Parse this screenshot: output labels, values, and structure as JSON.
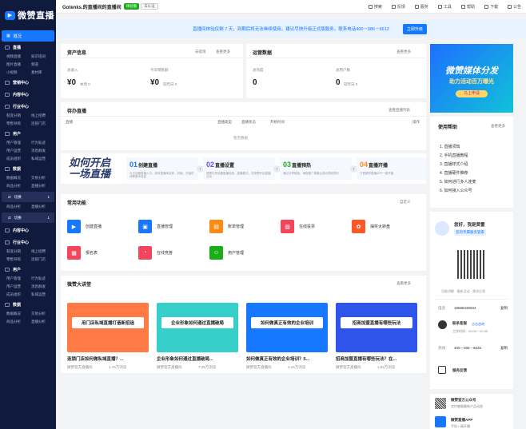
{
  "brand": {
    "logo_text": "微赞直播"
  },
  "sidebar": {
    "overview": "概况",
    "sections": [
      {
        "title": "直播",
        "items": [
          "视频直播",
          "知识培训",
          "图片直播",
          "频道",
          "小视频",
          "素材库"
        ]
      },
      {
        "title": "营销中心",
        "items": []
      },
      {
        "title": "内容中心",
        "items": []
      },
      {
        "title": "行业中心",
        "items": [
          "裂变分销",
          "线上招聘",
          "零售导购",
          "连锁门店"
        ]
      },
      {
        "title": "用户",
        "items": [
          "用户管理",
          "行为轨迹",
          "用户运营",
          "消息群发",
          "成员组织",
          "私域运营"
        ]
      },
      {
        "title": "数据",
        "items": [
          "数据概况",
          "交易分析",
          "商品分析",
          "直播分析"
        ]
      }
    ],
    "collapse_label": "切换",
    "collapse_count": "1",
    "lower_items_a": [
      "商品分析",
      "直播分析"
    ],
    "lower_collapse_label": "切换",
    "lower_collapse_count": "1",
    "lower_sections": [
      {
        "title": "内容中心",
        "items": []
      },
      {
        "title": "行业中心",
        "items": [
          "裂变分销",
          "线上招聘",
          "零售导购",
          "连锁门店"
        ]
      },
      {
        "title": "用户",
        "items": [
          "用户管理",
          "行为轨迹",
          "用户运营",
          "消息群发",
          "成员组织",
          "私域运营"
        ]
      },
      {
        "title": "数据",
        "items": [
          "数据概况",
          "交易分析",
          "商品分析",
          "直播分析"
        ]
      }
    ]
  },
  "topbar": {
    "room_name": "Gotenks.的直播间的直播间",
    "badge": "体验版",
    "cert": "去认证",
    "nav": [
      "搜索",
      "反馈",
      "服务",
      "工具",
      "帮助",
      "下载",
      "公告"
    ]
  },
  "banner": {
    "text": "直播间体验仅剩 7 天，到期后将无法继续使用，建议尽快升级正式版服务。联系电话400－086－6612",
    "button": "立即升级"
  },
  "assets": {
    "title": "资产信息",
    "withdraw": "去提现",
    "more": "查看更多",
    "total_label": "总收入",
    "total_value": "¥0",
    "total_sub": "本周 0",
    "today_label": "今日销售额",
    "today_value": "¥0",
    "today_sub": "较昨日 0"
  },
  "ops": {
    "title": "运营数据",
    "more": "查看更多",
    "views_label": "总热度",
    "views_value": "0",
    "users_label": "总用户数",
    "users_value": "0",
    "users_sub": "较昨日 0"
  },
  "pending": {
    "title": "待办直播",
    "more": "查看直播列表",
    "cols": [
      "直播",
      "直播类型",
      "直播状态",
      "开始时间",
      "操作"
    ],
    "empty": "暂无数据"
  },
  "promo": {
    "slogan_1": "如何开启",
    "slogan_2": "一场直播",
    "steps": [
      {
        "num": "01",
        "title": "创建直播",
        "desc": "点击创建直播入口，填写直播间名称，封面，开始时间等基本信息",
        "color": "#1677ff"
      },
      {
        "num": "02",
        "title": "直播设置",
        "desc": "根据引导设置直播信息，直播模式，并按需开启直播互动",
        "color": "#6b4ee6"
      },
      {
        "num": "03",
        "title": "直播预热",
        "desc": "通过分享链接、海报推广渠道让观众提前预约",
        "color": "#1aad19"
      },
      {
        "num": "04",
        "title": "直播开播",
        "desc": "下载微赞直播APP一键开播",
        "color": "#fa8c16"
      }
    ]
  },
  "functions": {
    "title": "常用功能",
    "setting": "自定义",
    "items": [
      {
        "label": "创建直播",
        "icon": "video-icon",
        "color": "#1677ff"
      },
      {
        "label": "直播管理",
        "icon": "folder-icon",
        "color": "#1677ff"
      },
      {
        "label": "账单管理",
        "icon": "bill-icon",
        "color": "#fa8c16"
      },
      {
        "label": "在线投票",
        "icon": "vote-icon",
        "color": "#f5455c"
      },
      {
        "label": "抽奖大转盘",
        "icon": "wheel-icon",
        "color": "#fa5a28"
      },
      {
        "label": "报名表",
        "icon": "form-icon",
        "color": "#f5455c"
      },
      {
        "label": "在线竞答",
        "icon": "quiz-icon",
        "color": "#f5455c"
      },
      {
        "label": "用户管理",
        "icon": "user-icon",
        "color": "#1aad19"
      }
    ]
  },
  "classroom": {
    "title": "微赞大讲堂",
    "more": "查看更多",
    "courses": [
      {
        "title": "连锁门店如何做私域直播？...",
        "author": "微赞官方直播间",
        "views": "1.76万浏览",
        "cover_text": "用门店私域直播打造新招追",
        "bg": "#ff7a45"
      },
      {
        "title": "企业形象如何通过直播破局...",
        "author": "微赞官方直播间",
        "views": "7.29万浏览",
        "cover_text": "企业形象如何通过直播破局",
        "bg": "#36cfc9"
      },
      {
        "title": "如何做真正有效的企业培训？5...",
        "author": "微赞官方直播间",
        "views": "3.44万浏览",
        "cover_text": "如何做真正有效的企业培训",
        "bg": "#1677ff"
      },
      {
        "title": "招商加盟直播有哪些玩法？在...",
        "author": "微赞官方直播间",
        "views": "1.63万浏览",
        "cover_text": "招商加盟直播有哪些玩法",
        "bg": "#2f54eb"
      }
    ]
  },
  "ad": {
    "line1": "微赞媒体分发",
    "line2": "助力活动百万曝光",
    "cta": "马上申请"
  },
  "help": {
    "title": "使用帮助",
    "more": "查看更多",
    "items": [
      "1. 直播须知",
      "2. 手机直播教程",
      "3. 直播样式介绍",
      "4. 直播硬件推荐",
      "5. 如何进行多人连麦",
      "6. 如何接入公众号"
    ]
  },
  "advisor": {
    "greet": "您好，我是黄雷",
    "role": "您的专属服务管家",
    "qr_caption": "功能讲解 · 最新活动 · 需求反馈",
    "phone_label": "电话",
    "phone": "18688436504",
    "copy": "复制",
    "online_label": "联系客服",
    "online_link": "点击咨询",
    "hours": "工作时间：09:00－22:00",
    "hotline_label": "热线",
    "hotline": "400－086－6625",
    "copy2": "复制",
    "feedback": "服务反馈"
  },
  "follow": [
    {
      "title": "微赞官方公众号",
      "sub": "实时掌握最新产品动态"
    },
    {
      "title": "微赞直播APP",
      "sub": "手机一键开播"
    }
  ]
}
